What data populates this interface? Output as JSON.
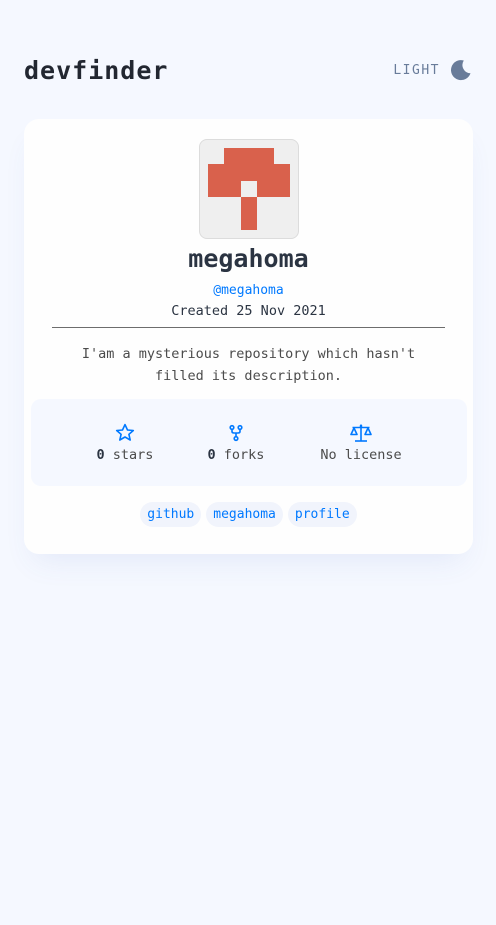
{
  "header": {
    "logo": "devfinder",
    "theme_label": "LIGHT"
  },
  "profile": {
    "name": "megahoma",
    "login": "@megahoma",
    "created": "Created 25 Nov 2021",
    "bio": "I'am a mysterious repository which hasn't filled its description.",
    "avatar_color": "#d9614c"
  },
  "stats": {
    "stars_count": "0",
    "stars_label": " stars",
    "forks_count": "0",
    "forks_label": " forks",
    "license": "No license"
  },
  "tags": [
    "github",
    "megahoma",
    "profile"
  ],
  "colors": {
    "accent": "#0079ff",
    "background": "#f5f8ff",
    "card": "#fefefe",
    "text": "#2b3442",
    "muted": "#697c9a"
  },
  "icons": {
    "theme": "moon-icon",
    "stars": "star-icon",
    "forks": "fork-icon",
    "license": "scale-icon"
  }
}
